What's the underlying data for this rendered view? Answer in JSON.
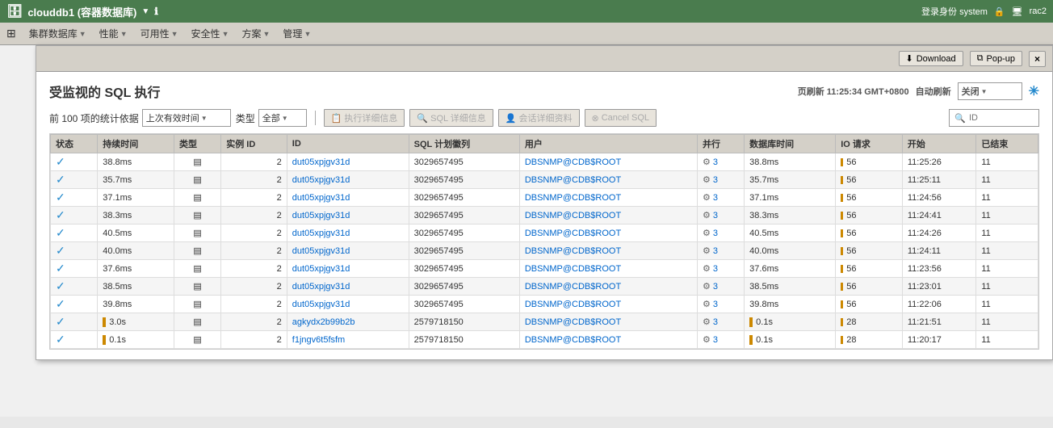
{
  "topbar": {
    "title": "clouddb1 (容器数据库)",
    "login_info": "登录身份 system",
    "instance": "rac2"
  },
  "navbar": {
    "items": [
      "集群数据库",
      "性能",
      "可用性",
      "安全性",
      "方案",
      "管理"
    ]
  },
  "popup": {
    "download_label": "Download",
    "popup_label": "Pop-up",
    "close_label": "×"
  },
  "page_title": "受监视的 SQL 执行",
  "refresh_info": "页刷新  11:25:34 GMT+0800",
  "auto_refresh_label": "自动刷新",
  "auto_refresh_value": "关闭",
  "toolbar": {
    "stats_label": "前 100 项的统计依据",
    "time_select": "上次有效时间",
    "type_label": "类型",
    "type_select": "全部",
    "btn_exec_detail": "执行详细信息",
    "btn_sql_detail": "SQL 详细信息",
    "btn_session_detail": "会话详细资料",
    "btn_cancel_sql": "Cancel SQL",
    "search_placeholder": "ID"
  },
  "table": {
    "headers": [
      "状态",
      "持续时间",
      "类型",
      "实例 ID",
      "ID",
      "SQL 计划徽列",
      "用户",
      "并行",
      "数据库时间",
      "IO 请求",
      "开始",
      "已结束"
    ],
    "rows": [
      {
        "status": "✓",
        "duration": "38.8ms",
        "type": "▤",
        "instance_id": "2",
        "id": "dut05xpjgv31d",
        "plan": "3029657495",
        "user": "DBSNMP@CDB$ROOT",
        "parallel": "3",
        "db_time": "38.8ms",
        "io_req": "56",
        "start": "11:25:26",
        "end": "11"
      },
      {
        "status": "✓",
        "duration": "35.7ms",
        "type": "▤",
        "instance_id": "2",
        "id": "dut05xpjgv31d",
        "plan": "3029657495",
        "user": "DBSNMP@CDB$ROOT",
        "parallel": "3",
        "db_time": "35.7ms",
        "io_req": "56",
        "start": "11:25:11",
        "end": "11"
      },
      {
        "status": "✓",
        "duration": "37.1ms",
        "type": "▤",
        "instance_id": "2",
        "id": "dut05xpjgv31d",
        "plan": "3029657495",
        "user": "DBSNMP@CDB$ROOT",
        "parallel": "3",
        "db_time": "37.1ms",
        "io_req": "56",
        "start": "11:24:56",
        "end": "11"
      },
      {
        "status": "✓",
        "duration": "38.3ms",
        "type": "▤",
        "instance_id": "2",
        "id": "dut05xpjgv31d",
        "plan": "3029657495",
        "user": "DBSNMP@CDB$ROOT",
        "parallel": "3",
        "db_time": "38.3ms",
        "io_req": "56",
        "start": "11:24:41",
        "end": "11"
      },
      {
        "status": "✓",
        "duration": "40.5ms",
        "type": "▤",
        "instance_id": "2",
        "id": "dut05xpjgv31d",
        "plan": "3029657495",
        "user": "DBSNMP@CDB$ROOT",
        "parallel": "3",
        "db_time": "40.5ms",
        "io_req": "56",
        "start": "11:24:26",
        "end": "11"
      },
      {
        "status": "✓",
        "duration": "40.0ms",
        "type": "▤",
        "instance_id": "2",
        "id": "dut05xpjgv31d",
        "plan": "3029657495",
        "user": "DBSNMP@CDB$ROOT",
        "parallel": "3",
        "db_time": "40.0ms",
        "io_req": "56",
        "start": "11:24:11",
        "end": "11"
      },
      {
        "status": "✓",
        "duration": "37.6ms",
        "type": "▤",
        "instance_id": "2",
        "id": "dut05xpjgv31d",
        "plan": "3029657495",
        "user": "DBSNMP@CDB$ROOT",
        "parallel": "3",
        "db_time": "37.6ms",
        "io_req": "56",
        "start": "11:23:56",
        "end": "11"
      },
      {
        "status": "✓",
        "duration": "38.5ms",
        "type": "▤",
        "instance_id": "2",
        "id": "dut05xpjgv31d",
        "plan": "3029657495",
        "user": "DBSNMP@CDB$ROOT",
        "parallel": "3",
        "db_time": "38.5ms",
        "io_req": "56",
        "start": "11:23:01",
        "end": "11"
      },
      {
        "status": "✓",
        "duration": "39.8ms",
        "type": "▤",
        "instance_id": "2",
        "id": "dut05xpjgv31d",
        "plan": "3029657495",
        "user": "DBSNMP@CDB$ROOT",
        "parallel": "3",
        "db_time": "39.8ms",
        "io_req": "56",
        "start": "11:22:06",
        "end": "11"
      },
      {
        "status": "✓",
        "duration": "3.0s",
        "type": "▤",
        "instance_id": "2",
        "id": "agkydx2b99b2b",
        "plan": "2579718150",
        "user": "DBSNMP@CDB$ROOT",
        "parallel": "3",
        "db_time": "0.1s",
        "io_req": "28",
        "start": "11:21:51",
        "end": "11"
      },
      {
        "status": "✓",
        "duration": "0.1s",
        "type": "▤",
        "instance_id": "2",
        "id": "f1jngv6t5fsfm",
        "plan": "2579718150",
        "user": "DBSNMP@CDB$ROOT",
        "parallel": "3",
        "db_time": "0.1s",
        "io_req": "28",
        "start": "11:20:17",
        "end": "11"
      }
    ]
  }
}
